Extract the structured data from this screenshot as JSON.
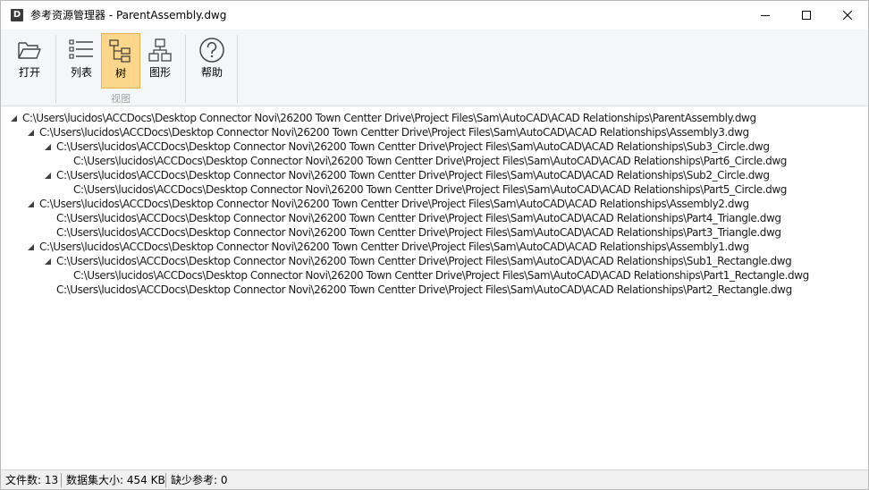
{
  "window": {
    "title": "参考资源管理器 - ParentAssembly.dwg",
    "app_icon_letter": "D"
  },
  "ribbon": {
    "open_label": "打开",
    "list_label": "列表",
    "tree_label": "树",
    "graph_label": "图形",
    "help_label": "帮助",
    "view_group_label": "视图",
    "active_button": "tree"
  },
  "tree": {
    "nodes": [
      {
        "depth": 0,
        "expanded": true,
        "text": "C:\\Users\\lucidos\\ACCDocs\\Desktop Connector Novi\\26200 Town Centter Drive\\Project Files\\Sam\\AutoCAD\\ACAD Relationships\\ParentAssembly.dwg"
      },
      {
        "depth": 1,
        "expanded": true,
        "text": "C:\\Users\\lucidos\\ACCDocs\\Desktop Connector Novi\\26200 Town Centter Drive\\Project Files\\Sam\\AutoCAD\\ACAD Relationships\\Assembly3.dwg"
      },
      {
        "depth": 2,
        "expanded": true,
        "text": "C:\\Users\\lucidos\\ACCDocs\\Desktop Connector Novi\\26200 Town Centter Drive\\Project Files\\Sam\\AutoCAD\\ACAD Relationships\\Sub3_Circle.dwg"
      },
      {
        "depth": 3,
        "expanded": false,
        "text": "C:\\Users\\lucidos\\ACCDocs\\Desktop Connector Novi\\26200 Town Centter Drive\\Project Files\\Sam\\AutoCAD\\ACAD Relationships\\Part6_Circle.dwg"
      },
      {
        "depth": 2,
        "expanded": true,
        "text": "C:\\Users\\lucidos\\ACCDocs\\Desktop Connector Novi\\26200 Town Centter Drive\\Project Files\\Sam\\AutoCAD\\ACAD Relationships\\Sub2_Circle.dwg"
      },
      {
        "depth": 3,
        "expanded": false,
        "text": "C:\\Users\\lucidos\\ACCDocs\\Desktop Connector Novi\\26200 Town Centter Drive\\Project Files\\Sam\\AutoCAD\\ACAD Relationships\\Part5_Circle.dwg"
      },
      {
        "depth": 1,
        "expanded": true,
        "text": "C:\\Users\\lucidos\\ACCDocs\\Desktop Connector Novi\\26200 Town Centter Drive\\Project Files\\Sam\\AutoCAD\\ACAD Relationships\\Assembly2.dwg"
      },
      {
        "depth": 2,
        "expanded": false,
        "text": "C:\\Users\\lucidos\\ACCDocs\\Desktop Connector Novi\\26200 Town Centter Drive\\Project Files\\Sam\\AutoCAD\\ACAD Relationships\\Part4_Triangle.dwg"
      },
      {
        "depth": 2,
        "expanded": false,
        "text": "C:\\Users\\lucidos\\ACCDocs\\Desktop Connector Novi\\26200 Town Centter Drive\\Project Files\\Sam\\AutoCAD\\ACAD Relationships\\Part3_Triangle.dwg"
      },
      {
        "depth": 1,
        "expanded": true,
        "text": "C:\\Users\\lucidos\\ACCDocs\\Desktop Connector Novi\\26200 Town Centter Drive\\Project Files\\Sam\\AutoCAD\\ACAD Relationships\\Assembly1.dwg"
      },
      {
        "depth": 2,
        "expanded": true,
        "text": "C:\\Users\\lucidos\\ACCDocs\\Desktop Connector Novi\\26200 Town Centter Drive\\Project Files\\Sam\\AutoCAD\\ACAD Relationships\\Sub1_Rectangle.dwg"
      },
      {
        "depth": 3,
        "expanded": false,
        "text": "C:\\Users\\lucidos\\ACCDocs\\Desktop Connector Novi\\26200 Town Centter Drive\\Project Files\\Sam\\AutoCAD\\ACAD Relationships\\Part1_Rectangle.dwg"
      },
      {
        "depth": 2,
        "expanded": false,
        "text": "C:\\Users\\lucidos\\ACCDocs\\Desktop Connector Novi\\26200 Town Centter Drive\\Project Files\\Sam\\AutoCAD\\ACAD Relationships\\Part2_Rectangle.dwg"
      }
    ]
  },
  "status": {
    "file_count": "文件数: 13",
    "dataset_size": "数据集大小: 454 KB",
    "missing_refs": "缺少参考: 0"
  },
  "colors": {
    "active_button_bg": "#fcd68a",
    "ribbon_bg": "#f5f6f7",
    "status_bg": "#f0f0f0"
  }
}
